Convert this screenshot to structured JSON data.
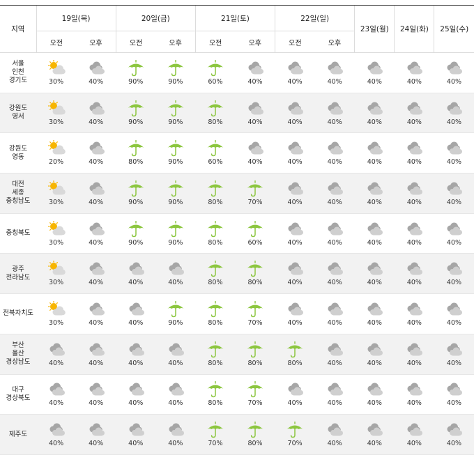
{
  "header": {
    "region_label": "지역",
    "am_label": "오전",
    "pm_label": "오후",
    "days_split": [
      "19일(목)",
      "20일(금)",
      "21일(토)",
      "22일(일)"
    ],
    "days_single": [
      "23일(월)",
      "24일(화)",
      "25일(수)"
    ]
  },
  "icon_names": {
    "sun": "sun-cloud-icon",
    "cloud": "cloudy-icon",
    "rain": "umbrella-rain-icon"
  },
  "colors": {
    "rain": "#8cc63f",
    "cloud": "#a6a6a6",
    "sun": "#f7b500",
    "alt_row": "#f2f2f2"
  },
  "rows": [
    {
      "region": [
        "서울",
        "인천",
        "경기도"
      ],
      "cells": [
        {
          "icon": "sun",
          "pct": "30%"
        },
        {
          "icon": "cloud",
          "pct": "40%"
        },
        {
          "icon": "rain",
          "pct": "90%"
        },
        {
          "icon": "rain",
          "pct": "90%"
        },
        {
          "icon": "rain",
          "pct": "60%"
        },
        {
          "icon": "cloud",
          "pct": "40%"
        },
        {
          "icon": "cloud",
          "pct": "40%"
        },
        {
          "icon": "cloud",
          "pct": "40%"
        },
        {
          "icon": "cloud",
          "pct": "40%"
        },
        {
          "icon": "cloud",
          "pct": "40%"
        },
        {
          "icon": "cloud",
          "pct": "40%"
        }
      ]
    },
    {
      "region": [
        "강원도",
        "영서"
      ],
      "cells": [
        {
          "icon": "sun",
          "pct": "30%"
        },
        {
          "icon": "cloud",
          "pct": "40%"
        },
        {
          "icon": "rain",
          "pct": "90%"
        },
        {
          "icon": "rain",
          "pct": "90%"
        },
        {
          "icon": "rain",
          "pct": "80%"
        },
        {
          "icon": "cloud",
          "pct": "40%"
        },
        {
          "icon": "cloud",
          "pct": "40%"
        },
        {
          "icon": "cloud",
          "pct": "40%"
        },
        {
          "icon": "cloud",
          "pct": "40%"
        },
        {
          "icon": "cloud",
          "pct": "40%"
        },
        {
          "icon": "cloud",
          "pct": "40%"
        }
      ]
    },
    {
      "region": [
        "강원도",
        "영동"
      ],
      "cells": [
        {
          "icon": "sun",
          "pct": "20%"
        },
        {
          "icon": "cloud",
          "pct": "40%"
        },
        {
          "icon": "rain",
          "pct": "80%"
        },
        {
          "icon": "rain",
          "pct": "90%"
        },
        {
          "icon": "rain",
          "pct": "60%"
        },
        {
          "icon": "cloud",
          "pct": "40%"
        },
        {
          "icon": "cloud",
          "pct": "40%"
        },
        {
          "icon": "cloud",
          "pct": "40%"
        },
        {
          "icon": "cloud",
          "pct": "40%"
        },
        {
          "icon": "cloud",
          "pct": "40%"
        },
        {
          "icon": "cloud",
          "pct": "40%"
        }
      ]
    },
    {
      "region": [
        "대전",
        "세종",
        "충청남도"
      ],
      "cells": [
        {
          "icon": "sun",
          "pct": "30%"
        },
        {
          "icon": "cloud",
          "pct": "40%"
        },
        {
          "icon": "rain",
          "pct": "90%"
        },
        {
          "icon": "rain",
          "pct": "90%"
        },
        {
          "icon": "rain",
          "pct": "80%"
        },
        {
          "icon": "rain",
          "pct": "70%"
        },
        {
          "icon": "cloud",
          "pct": "40%"
        },
        {
          "icon": "cloud",
          "pct": "40%"
        },
        {
          "icon": "cloud",
          "pct": "40%"
        },
        {
          "icon": "cloud",
          "pct": "40%"
        },
        {
          "icon": "cloud",
          "pct": "40%"
        }
      ]
    },
    {
      "region": [
        "충청북도"
      ],
      "cells": [
        {
          "icon": "sun",
          "pct": "30%"
        },
        {
          "icon": "cloud",
          "pct": "40%"
        },
        {
          "icon": "rain",
          "pct": "90%"
        },
        {
          "icon": "rain",
          "pct": "90%"
        },
        {
          "icon": "rain",
          "pct": "80%"
        },
        {
          "icon": "rain",
          "pct": "60%"
        },
        {
          "icon": "cloud",
          "pct": "40%"
        },
        {
          "icon": "cloud",
          "pct": "40%"
        },
        {
          "icon": "cloud",
          "pct": "40%"
        },
        {
          "icon": "cloud",
          "pct": "40%"
        },
        {
          "icon": "cloud",
          "pct": "40%"
        }
      ]
    },
    {
      "region": [
        "광주",
        "전라남도"
      ],
      "cells": [
        {
          "icon": "sun",
          "pct": "30%"
        },
        {
          "icon": "cloud",
          "pct": "40%"
        },
        {
          "icon": "cloud",
          "pct": "40%"
        },
        {
          "icon": "cloud",
          "pct": "40%"
        },
        {
          "icon": "rain",
          "pct": "80%"
        },
        {
          "icon": "rain",
          "pct": "80%"
        },
        {
          "icon": "cloud",
          "pct": "40%"
        },
        {
          "icon": "cloud",
          "pct": "40%"
        },
        {
          "icon": "cloud",
          "pct": "40%"
        },
        {
          "icon": "cloud",
          "pct": "40%"
        },
        {
          "icon": "cloud",
          "pct": "40%"
        }
      ]
    },
    {
      "region": [
        "전북자치도"
      ],
      "cells": [
        {
          "icon": "sun",
          "pct": "30%"
        },
        {
          "icon": "cloud",
          "pct": "40%"
        },
        {
          "icon": "cloud",
          "pct": "40%"
        },
        {
          "icon": "rain",
          "pct": "90%"
        },
        {
          "icon": "rain",
          "pct": "80%"
        },
        {
          "icon": "rain",
          "pct": "70%"
        },
        {
          "icon": "cloud",
          "pct": "40%"
        },
        {
          "icon": "cloud",
          "pct": "40%"
        },
        {
          "icon": "cloud",
          "pct": "40%"
        },
        {
          "icon": "cloud",
          "pct": "40%"
        },
        {
          "icon": "cloud",
          "pct": "40%"
        }
      ]
    },
    {
      "region": [
        "부산",
        "울산",
        "경상남도"
      ],
      "cells": [
        {
          "icon": "cloud",
          "pct": "40%"
        },
        {
          "icon": "cloud",
          "pct": "40%"
        },
        {
          "icon": "cloud",
          "pct": "40%"
        },
        {
          "icon": "cloud",
          "pct": "40%"
        },
        {
          "icon": "rain",
          "pct": "80%"
        },
        {
          "icon": "rain",
          "pct": "80%"
        },
        {
          "icon": "rain",
          "pct": "80%"
        },
        {
          "icon": "cloud",
          "pct": "40%"
        },
        {
          "icon": "cloud",
          "pct": "40%"
        },
        {
          "icon": "cloud",
          "pct": "40%"
        },
        {
          "icon": "cloud",
          "pct": "40%"
        }
      ]
    },
    {
      "region": [
        "대구",
        "경상북도"
      ],
      "cells": [
        {
          "icon": "cloud",
          "pct": "40%"
        },
        {
          "icon": "cloud",
          "pct": "40%"
        },
        {
          "icon": "cloud",
          "pct": "40%"
        },
        {
          "icon": "cloud",
          "pct": "40%"
        },
        {
          "icon": "rain",
          "pct": "80%"
        },
        {
          "icon": "rain",
          "pct": "70%"
        },
        {
          "icon": "cloud",
          "pct": "40%"
        },
        {
          "icon": "cloud",
          "pct": "40%"
        },
        {
          "icon": "cloud",
          "pct": "40%"
        },
        {
          "icon": "cloud",
          "pct": "40%"
        },
        {
          "icon": "cloud",
          "pct": "40%"
        }
      ]
    },
    {
      "region": [
        "제주도"
      ],
      "cells": [
        {
          "icon": "cloud",
          "pct": "40%"
        },
        {
          "icon": "cloud",
          "pct": "40%"
        },
        {
          "icon": "cloud",
          "pct": "40%"
        },
        {
          "icon": "cloud",
          "pct": "40%"
        },
        {
          "icon": "rain",
          "pct": "70%"
        },
        {
          "icon": "rain",
          "pct": "80%"
        },
        {
          "icon": "rain",
          "pct": "70%"
        },
        {
          "icon": "cloud",
          "pct": "40%"
        },
        {
          "icon": "cloud",
          "pct": "40%"
        },
        {
          "icon": "cloud",
          "pct": "40%"
        },
        {
          "icon": "cloud",
          "pct": "40%"
        }
      ]
    }
  ]
}
